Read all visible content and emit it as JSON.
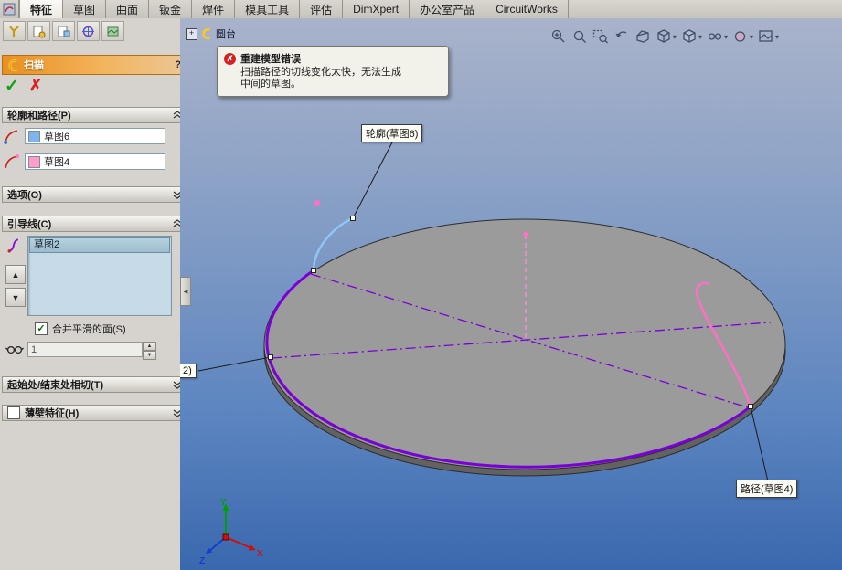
{
  "colors": {
    "guide_purple": "#7a00d8",
    "path_pink": "#ff6fc4",
    "profile_blue": "#8ec6f5",
    "disc_gray": "#9b9b9b",
    "title_orange": "#e98f1f",
    "viewport_top": "#a9b3ca",
    "viewport_bottom": "#3a68ae"
  },
  "icons": {
    "check": "✓",
    "cross": "✗",
    "help": "?",
    "plus": "+",
    "up": "▲",
    "down": "▼",
    "caret_down": "▾",
    "collapse_left": "◀"
  },
  "tab_bar": {
    "tabs": [
      {
        "label": "特征"
      },
      {
        "label": "草图"
      },
      {
        "label": "曲面"
      },
      {
        "label": "钣金"
      },
      {
        "label": "焊件"
      },
      {
        "label": "模具工具"
      },
      {
        "label": "评估"
      },
      {
        "label": "DimXpert"
      },
      {
        "label": "办公室产品"
      },
      {
        "label": "CircuitWorks"
      }
    ]
  },
  "panel": {
    "title": "扫描",
    "sections": {
      "profile_path": "轮廓和路径(P)",
      "options": "选项(O)",
      "guides": "引导线(C)",
      "tangency": "起始处/结束处相切(T)",
      "thin": "薄壁特征(H)"
    },
    "profile_value": "草图6",
    "path_value": "草图4",
    "guide_selected": "草图2",
    "merge_label": "合并平滑的面(S)",
    "spin_value": "1"
  },
  "viewport": {
    "tree_item": "圆台",
    "error_title": "重建模型错误",
    "error_line1": "扫描路径的切线变化太快，无法生成",
    "error_line2": "中间的草图。",
    "callout_profile": "轮廓(草图6)",
    "callout_path": "路径(草图4)",
    "callout_guide_clipped": "2)",
    "triad_x": "X",
    "triad_y": "Y",
    "triad_z": "Z"
  }
}
